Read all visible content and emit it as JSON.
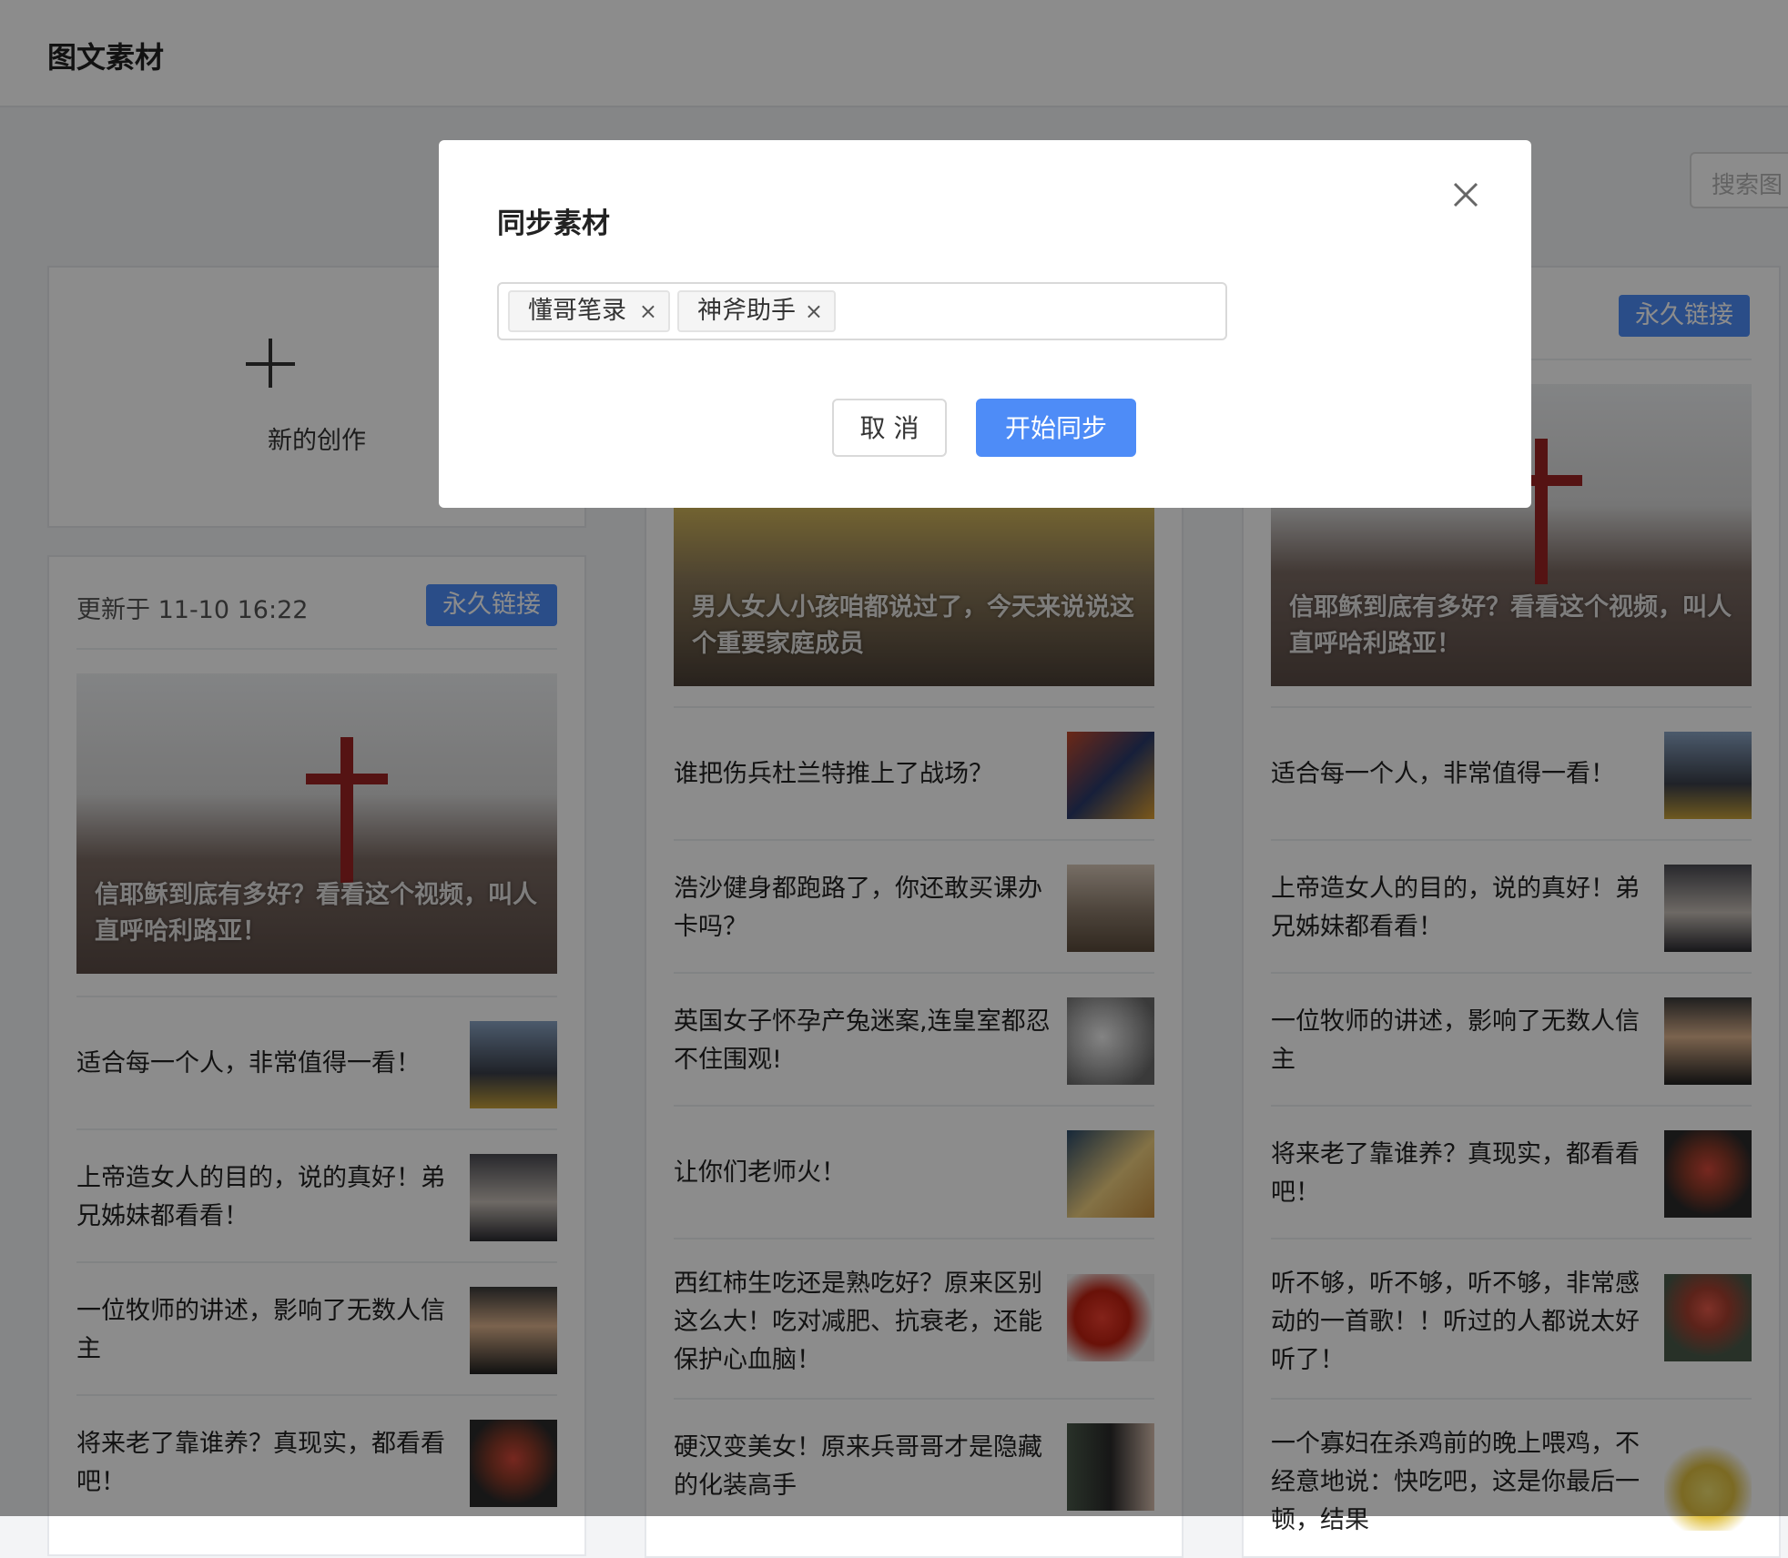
{
  "header": {
    "title": "图文素材"
  },
  "search": {
    "placeholder": "搜索图"
  },
  "new_creation": {
    "label": "新的创作"
  },
  "badge_label": "永久链接",
  "col1": {
    "meta": "更新于 11-10 16:22",
    "cover_caption": "信耶稣到底有多好？看看这个视频，叫人直呼哈利路亚！",
    "items": [
      "适合每一个人，非常值得一看！",
      "上帝造女人的目的，说的真好！弟兄姊妹都看看！",
      "一位牧师的讲述，影响了无数人信主",
      "将来老了靠谁养？真现实，都看看吧！"
    ]
  },
  "col2": {
    "cover_caption": "男人女人小孩咱都说过了，今天来说说这个重要家庭成员",
    "items": [
      "谁把伤兵杜兰特推上了战场？",
      "浩沙健身都跑路了，你还敢买课办卡吗？",
      "英国女子怀孕产兔迷案,连皇室都忍不住围观!",
      "让你们老师火！",
      "西红柿生吃还是熟吃好？原来区别这么大！吃对减肥、抗衰老，还能保护心血脑！",
      "硬汉变美女！原来兵哥哥才是隐藏的化装高手"
    ]
  },
  "col3": {
    "cover_caption": "信耶稣到底有多好？看看这个视频，叫人直呼哈利路亚！",
    "items": [
      "适合每一个人，非常值得一看！",
      "上帝造女人的目的，说的真好！弟兄姊妹都看看！",
      "一位牧师的讲述，影响了无数人信主",
      "将来老了靠谁养？真现实，都看看吧！",
      "听不够，听不够，听不够，非常感动的一首歌！！听过的人都说太好听了！",
      "一个寡妇在杀鸡前的晚上喂鸡，不经意地说：快吃吧，这是你最后一顿，结果"
    ]
  },
  "modal": {
    "title": "同步素材",
    "tags": [
      "懂哥笔录",
      "神斧助手"
    ],
    "tag_remove": "×",
    "cancel_label": "取 消",
    "start_label": "开始同步"
  },
  "colors": {
    "primary": "#4e8cf7",
    "overlay": "rgba(0,0,0,0.45)"
  }
}
